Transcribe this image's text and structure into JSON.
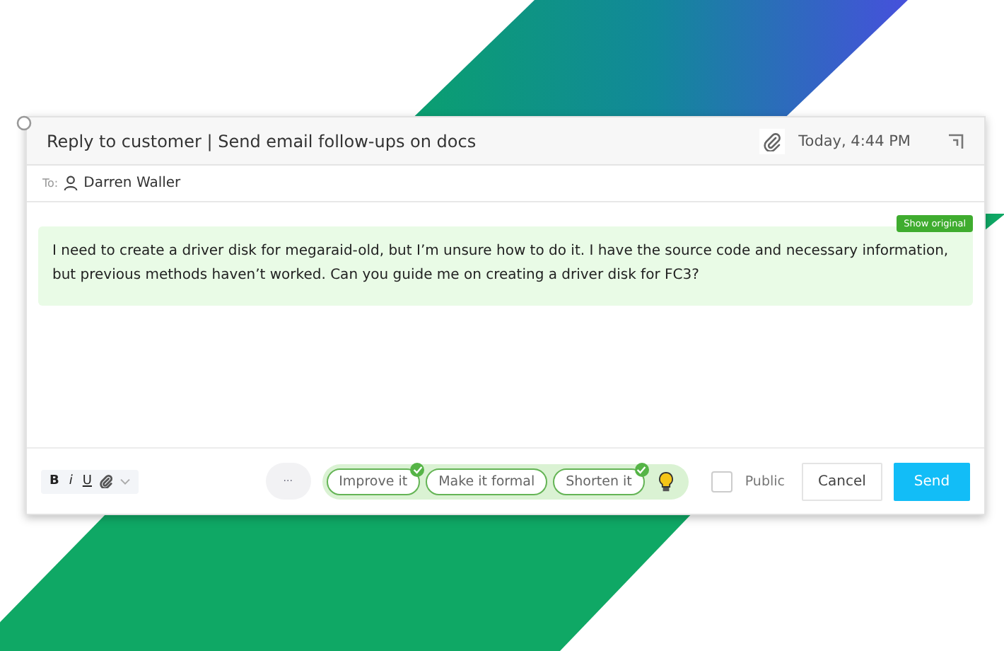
{
  "window": {
    "title": "Reply to customer | Send email follow-ups on docs",
    "time": "Today, 4:44 PM"
  },
  "recipient": {
    "label": "To:",
    "name": "Darren Waller"
  },
  "message": {
    "text": "I need to create a driver disk for megaraid-old, but I’m unsure how to do it. I have the source code and necessary information, but previous methods haven’t worked. Can you guide me on creating a driver disk for FC3?",
    "badge": "Show original"
  },
  "format_buttons": [
    {
      "label": "B",
      "kind": "bold"
    },
    {
      "label": "i",
      "kind": "italic"
    },
    {
      "label": "U",
      "kind": "underline"
    }
  ],
  "more_button": "···",
  "suggestions": [
    {
      "label": "Improve it",
      "applied": true
    },
    {
      "label": "Make it formal",
      "applied": false
    },
    {
      "label": "Shorten it",
      "applied": true
    }
  ],
  "public": {
    "label": "Public",
    "checked": false
  },
  "buttons": [
    {
      "label": "Cancel",
      "kind": "secondary"
    },
    {
      "label": "Send",
      "kind": "primary"
    }
  ]
}
